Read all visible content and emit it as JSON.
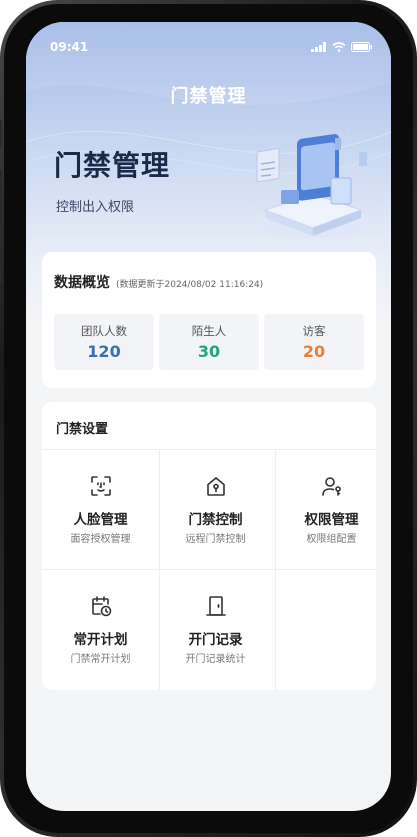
{
  "status_bar": {
    "time": "09:41"
  },
  "nav": {
    "title": "门禁管理"
  },
  "hero": {
    "title": "门禁管理",
    "subtitle": "控制出入权限"
  },
  "overview": {
    "title": "数据概览",
    "update_note": "(数据更新于2024/08/02 11:16:24)",
    "stats": [
      {
        "label": "团队人数",
        "value": "120",
        "color": "#3b6fb5"
      },
      {
        "label": "陌生人",
        "value": "30",
        "color": "#1fa67a"
      },
      {
        "label": "访客",
        "value": "20",
        "color": "#ef7d2c"
      }
    ]
  },
  "settings": {
    "title": "门禁设置",
    "items": [
      {
        "icon": "face-scan-icon",
        "title": "人脸管理",
        "subtitle": "面容授权管理"
      },
      {
        "icon": "home-lock-icon",
        "title": "门禁控制",
        "subtitle": "远程门禁控制"
      },
      {
        "icon": "user-key-icon",
        "title": "权限管理",
        "subtitle": "权限组配置"
      },
      {
        "icon": "calendar-clock-icon",
        "title": "常开计划",
        "subtitle": "门禁常开计划"
      },
      {
        "icon": "door-icon",
        "title": "开门记录",
        "subtitle": "开门记录统计"
      }
    ]
  }
}
